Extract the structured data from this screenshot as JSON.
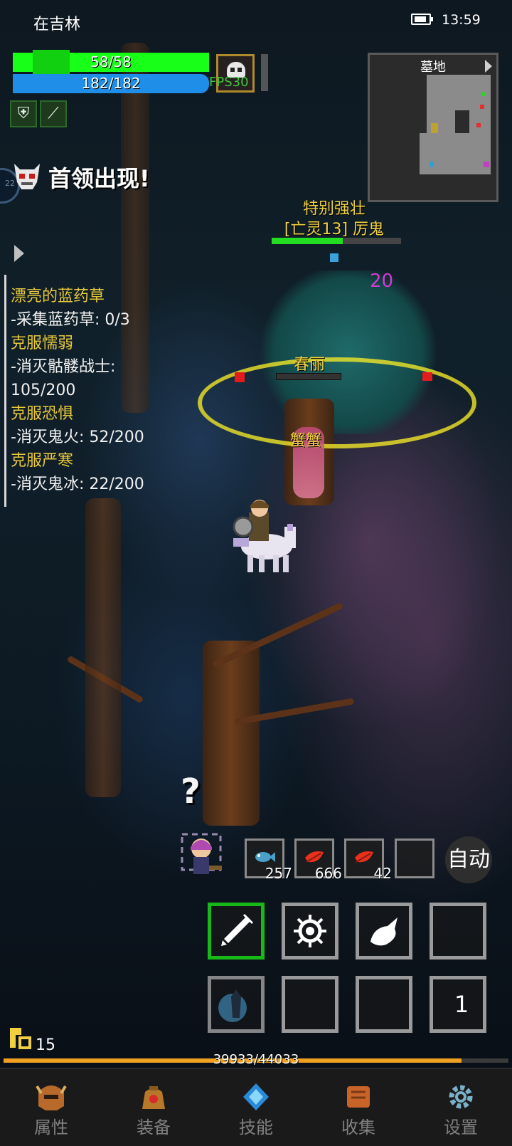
{
  "status_bar": {
    "title": "在吉林",
    "time": "13:59"
  },
  "player": {
    "hp_text": "58/58",
    "hp_fraction": 1.0,
    "mp_text": "182/182",
    "mp_fraction": 1.0,
    "fps_text": "FPS30",
    "level": "15",
    "xp_text": "39933/44033",
    "xp_fraction": 0.907
  },
  "minimap": {
    "title": "墓地"
  },
  "alert": {
    "text": "首领出现!",
    "side_badge": "22"
  },
  "quests": [
    {
      "title": "漂亮的蓝药草",
      "lines": [
        "-采集蓝药草: 0/3"
      ]
    },
    {
      "title": "克服懦弱",
      "lines": [
        "-消灭骷髅战士:",
        "105/200"
      ]
    },
    {
      "title": "克服恐惧",
      "lines": [
        "-消灭鬼火: 52/200"
      ]
    },
    {
      "title": "克服严寒",
      "lines": [
        "-消灭鬼冰: 22/200"
      ]
    }
  ],
  "enemy": {
    "modifier": "特别强壮",
    "name": "[亡灵13] 厉鬼",
    "hp_fraction": 0.55,
    "damage_number": "20"
  },
  "pets": {
    "pet1_name": "春丽",
    "pet2_name": "蟹蟹"
  },
  "consumables": [
    {
      "icon": "fish-icon",
      "count": "257",
      "color": "#4aa0c8"
    },
    {
      "icon": "red-leaf-icon",
      "count": "666",
      "color": "#e8301c"
    },
    {
      "icon": "red-leaf-icon",
      "count": "42",
      "color": "#e8301c"
    },
    {
      "icon": "empty-slot",
      "count": "",
      "color": ""
    }
  ],
  "auto_button_label": "自动",
  "quickslot_number": "1",
  "skills": [
    {
      "icon": "sword-slash-icon",
      "active": true
    },
    {
      "icon": "radiant-burst-icon",
      "active": false
    },
    {
      "icon": "beast-claw-icon",
      "active": false
    },
    {
      "icon": "empty-slot",
      "active": false
    },
    {
      "icon": "dark-knight-icon",
      "active": false
    },
    {
      "icon": "empty-slot",
      "active": false
    },
    {
      "icon": "empty-slot",
      "active": false
    },
    {
      "icon": "quickslot",
      "active": false
    }
  ],
  "nav": [
    {
      "label": "属性",
      "icon": "helmet-icon"
    },
    {
      "label": "装备",
      "icon": "bag-icon"
    },
    {
      "label": "技能",
      "icon": "crystal-icon"
    },
    {
      "label": "收集",
      "icon": "book-icon"
    },
    {
      "label": "设置",
      "icon": "gear-icon"
    }
  ],
  "colors": {
    "hp": "#18ff18",
    "mp": "#1f8ee8",
    "quest_title": "#e8c83a",
    "enemy_label": "#f0d040",
    "damage": "#d23ad2",
    "xp": "#f0a020"
  }
}
